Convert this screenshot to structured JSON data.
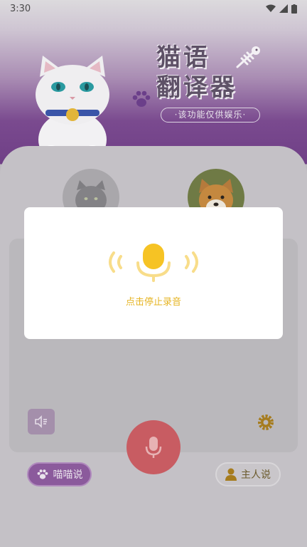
{
  "status_bar": {
    "time": "3:30"
  },
  "header": {
    "title_line1": "猫语",
    "title_line2": "翻译器",
    "subtitle": "·该功能仅供娱乐·"
  },
  "controls": {
    "cat_speak_label": "喵喵说",
    "owner_speak_label": "主人说"
  },
  "dialog": {
    "hint": "点击停止录音"
  },
  "colors": {
    "accent_yellow": "#f6c324",
    "purple": "#8b5a9c",
    "record_red": "#c85c62"
  }
}
